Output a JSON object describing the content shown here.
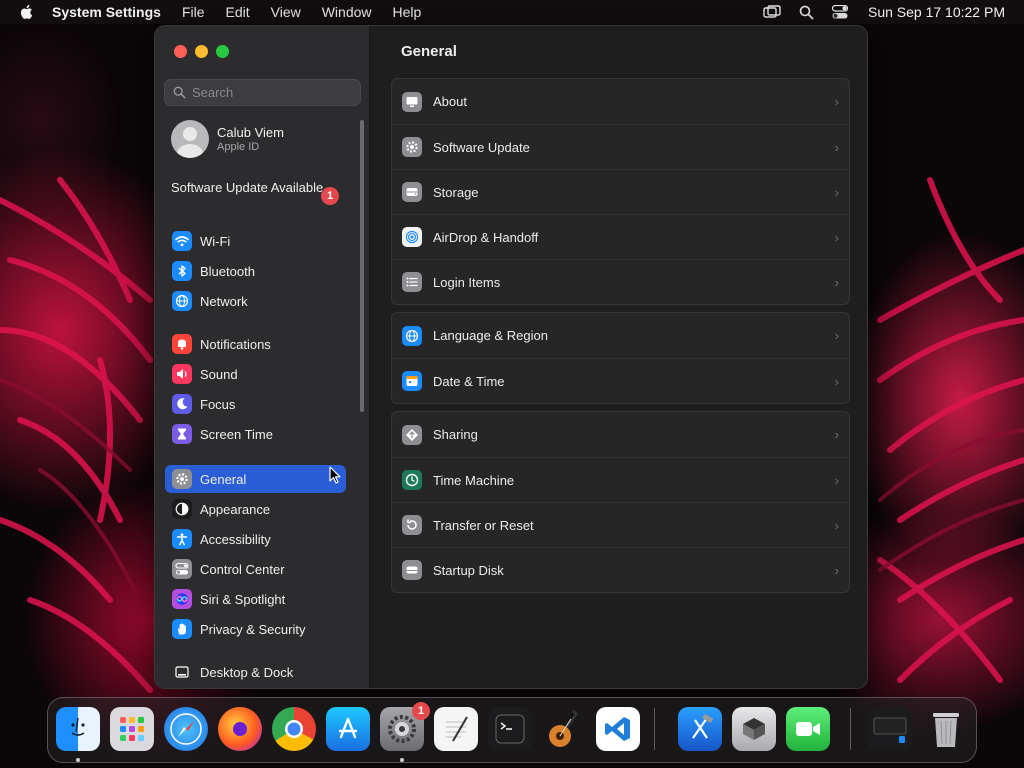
{
  "menubar": {
    "app_name": "System Settings",
    "items": [
      "File",
      "Edit",
      "View",
      "Window",
      "Help"
    ],
    "clock": "Sun Sep 17  10:22 PM",
    "icons": [
      "screen-mirroring-icon",
      "spotlight-search-icon",
      "control-center-icon"
    ]
  },
  "sidebar": {
    "search_placeholder": "Search",
    "profile": {
      "name": "Calub Viem",
      "subtitle": "Apple ID"
    },
    "update": {
      "label": "Software Update Available",
      "badge": "1"
    },
    "items": [
      {
        "label": "Wi-Fi",
        "icon": "wifi-icon",
        "color": "#1a8cff"
      },
      {
        "label": "Bluetooth",
        "icon": "bluetooth-icon",
        "color": "#1a8cff"
      },
      {
        "label": "Network",
        "icon": "globe-icon",
        "color": "#1a8cff"
      },
      {
        "label": "Notifications",
        "icon": "bell-icon",
        "color": "#ff453a"
      },
      {
        "label": "Sound",
        "icon": "speaker-icon",
        "color": "#ff375f"
      },
      {
        "label": "Focus",
        "icon": "moon-icon",
        "color": "#5e5ce6"
      },
      {
        "label": "Screen Time",
        "icon": "hourglass-icon",
        "color": "#7b5ce6"
      },
      {
        "label": "General",
        "icon": "gear-icon",
        "color": "#8e8e93",
        "active": true
      },
      {
        "label": "Appearance",
        "icon": "appearance-icon",
        "color": "#1c1c1e"
      },
      {
        "label": "Accessibility",
        "icon": "accessibility-icon",
        "color": "#1a8cff"
      },
      {
        "label": "Control Center",
        "icon": "control-center-icon",
        "color": "#8e8e93"
      },
      {
        "label": "Siri & Spotlight",
        "icon": "siri-icon",
        "color": "#b44de0"
      },
      {
        "label": "Privacy & Security",
        "icon": "hand-icon",
        "color": "#1a8cff"
      },
      {
        "label": "Desktop & Dock",
        "icon": "dock-icon",
        "color": "#2c2c2e"
      }
    ]
  },
  "main": {
    "title": "General",
    "groups": [
      [
        {
          "label": "About",
          "icon": "display-icon"
        },
        {
          "label": "Software Update",
          "icon": "gear-badge-icon"
        },
        {
          "label": "Storage",
          "icon": "drive-icon"
        },
        {
          "label": "AirDrop & Handoff",
          "icon": "airdrop-icon"
        },
        {
          "label": "Login Items",
          "icon": "list-icon"
        }
      ],
      [
        {
          "label": "Language & Region",
          "icon": "globe-icon"
        },
        {
          "label": "Date & Time",
          "icon": "calendar-icon"
        }
      ],
      [
        {
          "label": "Sharing",
          "icon": "sharing-icon"
        },
        {
          "label": "Time Machine",
          "icon": "time-machine-icon"
        },
        {
          "label": "Transfer or Reset",
          "icon": "reset-icon"
        },
        {
          "label": "Startup Disk",
          "icon": "disk-icon"
        }
      ]
    ]
  },
  "dock": {
    "settings_badge": "1",
    "apps": [
      "Finder",
      "Launchpad",
      "Safari",
      "Firefox",
      "Chrome",
      "App Store",
      "System Settings",
      "TextEdit",
      "Terminal",
      "GarageBand",
      "Visual Studio Code",
      "Xcode",
      "Boot Camp Assistant",
      "FaceTime",
      "Screen Sharing",
      "Trash"
    ]
  }
}
